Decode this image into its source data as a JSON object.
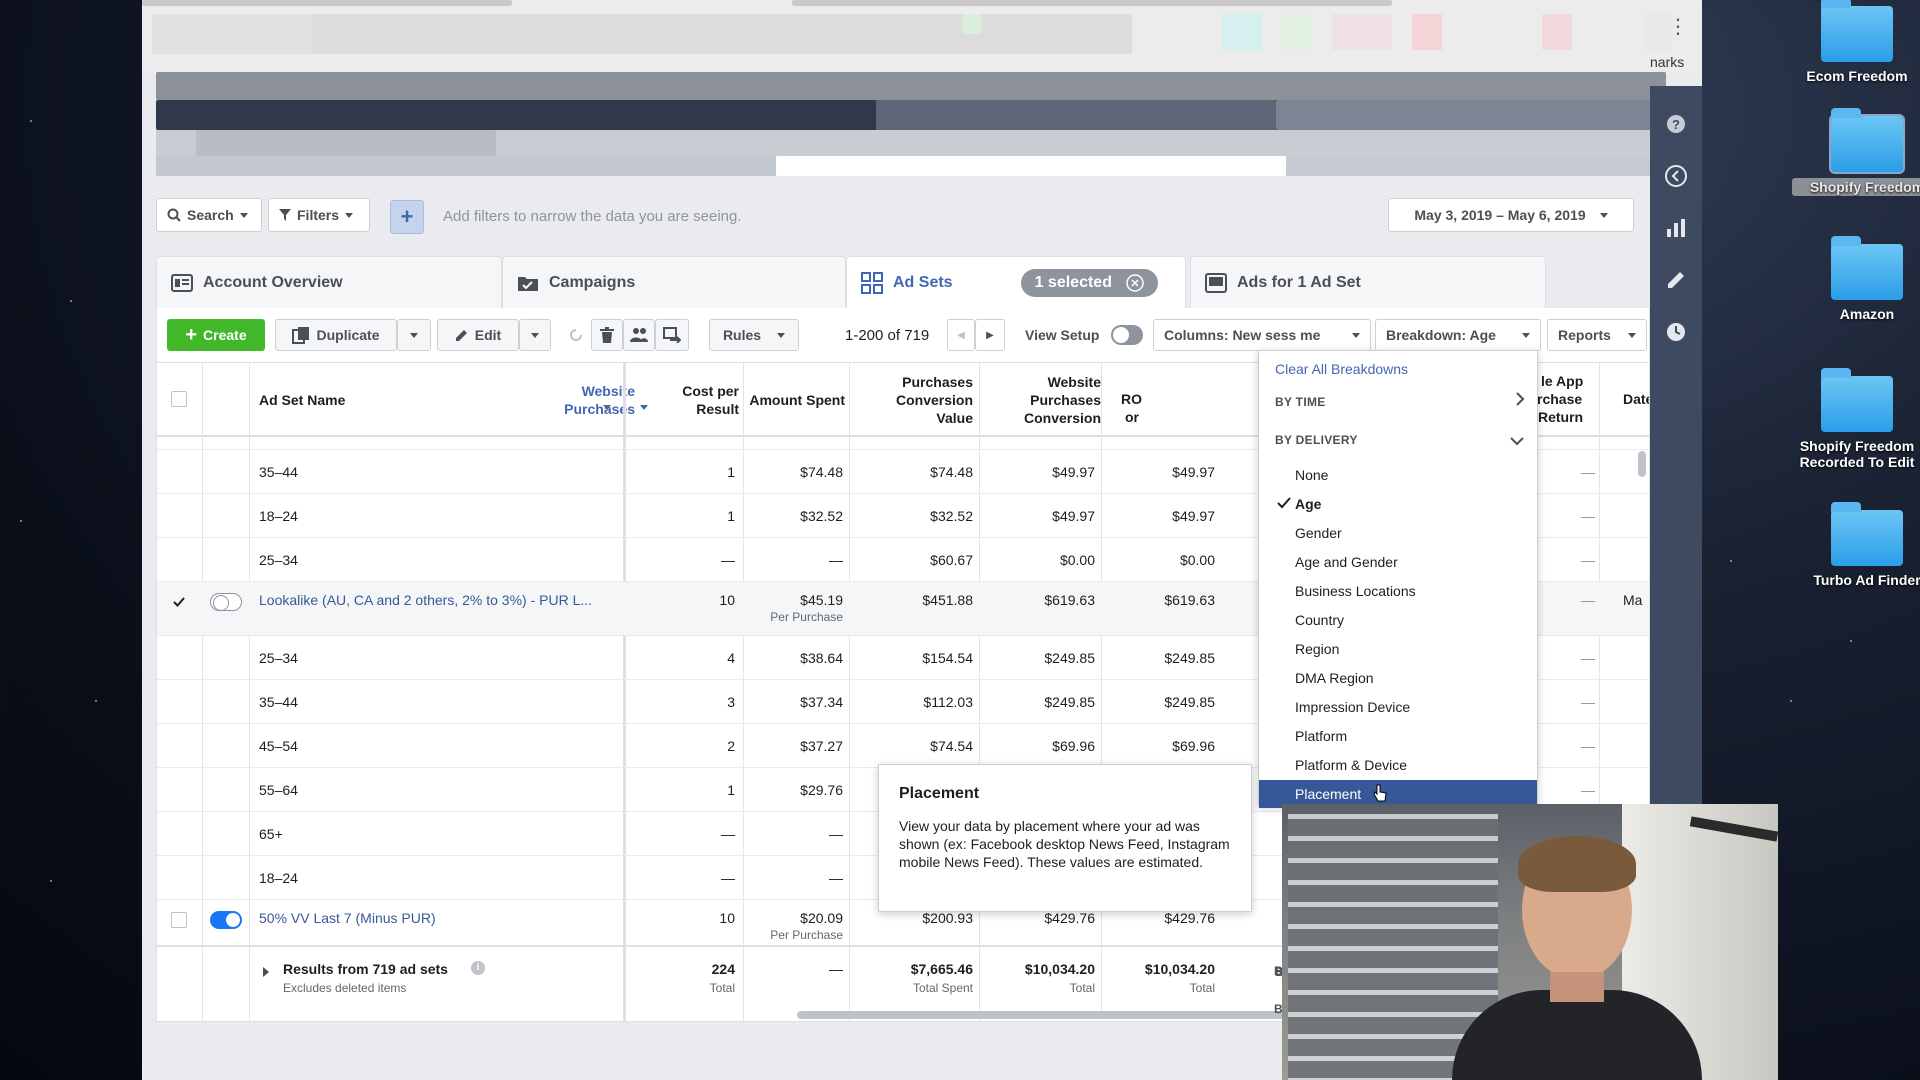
{
  "filter_bar": {
    "search_label": "Search",
    "filters_label": "Filters",
    "add_label": "+",
    "placeholder": "Add filters to narrow the data you are seeing.",
    "date_range": "May 3, 2019 – May 6, 2019"
  },
  "tabs": [
    {
      "label": "Account Overview"
    },
    {
      "label": "Campaigns"
    },
    {
      "label": "Ad Sets",
      "badge": "1 selected"
    },
    {
      "label": "Ads for 1 Ad Set"
    }
  ],
  "toolbar": {
    "create": "Create",
    "duplicate": "Duplicate",
    "edit": "Edit",
    "rules": "Rules",
    "pagination": "1-200 of 719",
    "view_setup": "View Setup",
    "columns": "Columns: New sess me",
    "breakdown": "Breakdown: Age",
    "reports": "Reports"
  },
  "table": {
    "headers": {
      "name": "Ad Set Name",
      "website_purchases": "Website Purchases",
      "cost_per_result": "Cost per Result",
      "amount_spent": "Amount Spent",
      "purchases_conv_value": "Purchases Conversion Value",
      "website_purchases_conv": "Website Purchases Conversion",
      "partial_ro": "RO",
      "partial_or": "or",
      "partial_app_1": "le App",
      "partial_app_2": "rchase",
      "partial_app_3": "Return",
      "partial_date": "Date"
    },
    "rows": [
      {
        "name": "35–44",
        "purchases": "1",
        "cost": "$74.48",
        "cost_sub": "",
        "spent": "$74.48",
        "conv_value": "$49.97",
        "web_conv": "$49.97",
        "extra": "—"
      },
      {
        "name": "18–24",
        "purchases": "1",
        "cost": "$32.52",
        "cost_sub": "",
        "spent": "$32.52",
        "conv_value": "$49.97",
        "web_conv": "$49.97",
        "extra": "—"
      },
      {
        "name": "25–34",
        "purchases": "—",
        "cost": "—",
        "cost_sub": "",
        "spent": "$60.67",
        "conv_value": "$0.00",
        "web_conv": "$0.00",
        "extra": "—"
      },
      {
        "name": "Lookalike (AU, CA and 2 others, 2% to 3%) - PUR L...",
        "purchases": "10",
        "cost": "$45.19",
        "cost_sub": "Per Purchase",
        "spent": "$451.88",
        "conv_value": "$619.63",
        "web_conv": "$619.63",
        "extra": "—",
        "date_partial": "Ma"
      },
      {
        "name": "25–34",
        "purchases": "4",
        "cost": "$38.64",
        "cost_sub": "",
        "spent": "$154.54",
        "conv_value": "$249.85",
        "web_conv": "$249.85",
        "extra": "—"
      },
      {
        "name": "35–44",
        "purchases": "3",
        "cost": "$37.34",
        "cost_sub": "",
        "spent": "$112.03",
        "conv_value": "$249.85",
        "web_conv": "$249.85",
        "extra": "—"
      },
      {
        "name": "45–54",
        "purchases": "2",
        "cost": "$37.27",
        "cost_sub": "",
        "spent": "$74.54",
        "conv_value": "$69.96",
        "web_conv": "$69.96",
        "extra": "—"
      },
      {
        "name": "55–64",
        "purchases": "1",
        "cost": "$29.76",
        "cost_sub": "",
        "spent": "",
        "conv_value": "",
        "web_conv": "",
        "extra": "—"
      },
      {
        "name": "65+",
        "purchases": "—",
        "cost": "—",
        "cost_sub": "",
        "spent": "",
        "conv_value": "",
        "web_conv": "",
        "extra": ""
      },
      {
        "name": "18–24",
        "purchases": "—",
        "cost": "—",
        "cost_sub": "",
        "spent": "",
        "conv_value": "",
        "web_conv": "",
        "extra": ""
      },
      {
        "name": "50% VV Last 7 (Minus PUR)",
        "purchases": "10",
        "cost": "$20.09",
        "cost_sub": "Per Purchase",
        "spent": "$200.93",
        "conv_value": "$429.76",
        "web_conv": "$429.76",
        "extra": ""
      }
    ],
    "totals": {
      "label": "Results from 719 ad sets",
      "sub": "Excludes deleted items",
      "purchases": "224",
      "purchases_sub": "Total",
      "cost": "—",
      "spent": "$7,665.46",
      "spent_sub": "Total Spent",
      "conv_value": "$10,034.20",
      "conv_value_sub": "Total",
      "web_conv": "$10,034.20",
      "web_conv_sub": "Total"
    }
  },
  "breakdown_menu": {
    "clear": "Clear All Breakdowns",
    "by_time": "BY TIME",
    "by_delivery": "BY DELIVERY",
    "items": [
      "None",
      "Age",
      "Gender",
      "Age and Gender",
      "Business Locations",
      "Country",
      "Region",
      "DMA Region",
      "Impression Device",
      "Platform",
      "Platform & Device",
      "Placement"
    ],
    "checked": "Age",
    "highlighted": "Placement",
    "hidden_peek_1": "B",
    "hidden_peek_2": "B"
  },
  "tooltip": {
    "title": "Placement",
    "body": "View your data by placement where your ad was shown (ex: Facebook desktop News Feed, Instagram mobile News Feed). These values are estimated."
  },
  "browser": {
    "bookmarks_partial": "narks"
  },
  "desktop_icons": [
    {
      "label": "Ecom Freedom"
    },
    {
      "label": "Shopify Freedom"
    },
    {
      "label": "Amazon"
    },
    {
      "label": "Shopify Freedom Recorded To Edit"
    },
    {
      "label": "Turbo Ad Finder"
    }
  ],
  "colors": {
    "accent": "#4267b2",
    "create_green": "#42b72a",
    "menu_highlight": "#365899",
    "rail": "#3d4a5f"
  }
}
